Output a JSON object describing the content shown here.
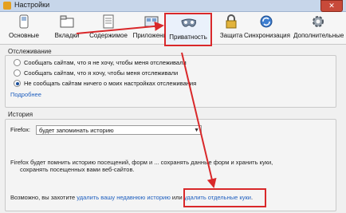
{
  "window": {
    "title": "Настройки",
    "close_symbol": "✕"
  },
  "toolbar": {
    "items": [
      {
        "label": "Основные",
        "icon": "switch-icon"
      },
      {
        "label": "Вкладки",
        "icon": "tabs-icon"
      },
      {
        "label": "Содержимое",
        "icon": "document-icon"
      },
      {
        "label": "Приложения",
        "icon": "applications-icon"
      },
      {
        "label": "Приватность",
        "icon": "mask-icon",
        "active": true
      },
      {
        "label": "Защита",
        "icon": "lock-icon"
      },
      {
        "label": "Синхронизация",
        "icon": "sync-icon"
      },
      {
        "label": "Дополнительные",
        "icon": "gear-icon"
      }
    ]
  },
  "tracking": {
    "title": "Отслеживание",
    "options": [
      {
        "label": "Сообщать сайтам, что я не хочу, чтобы меня отслеживали",
        "checked": false
      },
      {
        "label": "Сообщать сайтам, что я хочу, чтобы меня отслеживали",
        "checked": false
      },
      {
        "label": "Не сообщать сайтам ничего о моих настройках отслеживания",
        "checked": true
      }
    ],
    "more_link": "Подробнее"
  },
  "history": {
    "title": "История",
    "firefox_label": "Firefox:",
    "select_value": "будет запоминать историю",
    "description_line1": "Firefox будет помнить историю посещений, форм и ... сохранять данные форм и хранить куки,",
    "description_line2": "сохранять посещенных вами веб-сайтов.",
    "bottom_prefix": "Возможно, вы захотите ",
    "bottom_link1": "удалить вашу недавнюю историю",
    "bottom_middle": " или ",
    "bottom_link2": "удалить отдельные куки",
    "bottom_suffix": "."
  },
  "colors": {
    "highlight": "#d9282a",
    "link": "#1f5fbf"
  }
}
